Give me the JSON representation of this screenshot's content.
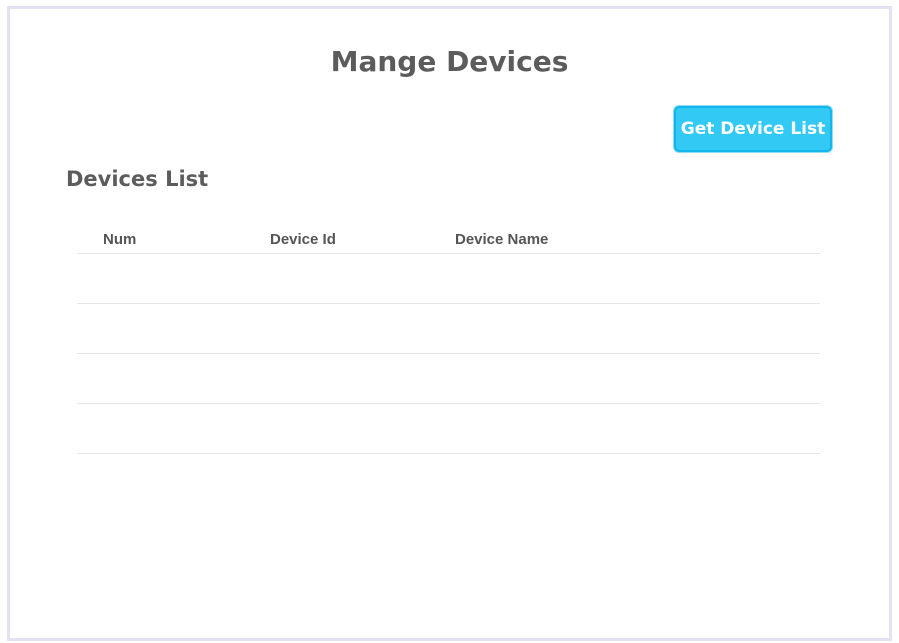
{
  "page": {
    "title": "Mange Devices"
  },
  "toolbar": {
    "get_device_list_label": "Get Device List"
  },
  "devices_section": {
    "title": "Devices List",
    "columns": [
      "Num",
      "Device Id",
      "Device Name"
    ],
    "rows": [
      {
        "num": "",
        "device_id": "",
        "device_name": ""
      },
      {
        "num": "",
        "device_id": "",
        "device_name": ""
      },
      {
        "num": "",
        "device_id": "",
        "device_name": ""
      },
      {
        "num": "",
        "device_id": "",
        "device_name": ""
      }
    ]
  },
  "colors": {
    "accent": "#32c9f5",
    "accent_border": "#12b6ea",
    "frame_border": "#e2e2f3",
    "text": "#5c5c5c"
  }
}
